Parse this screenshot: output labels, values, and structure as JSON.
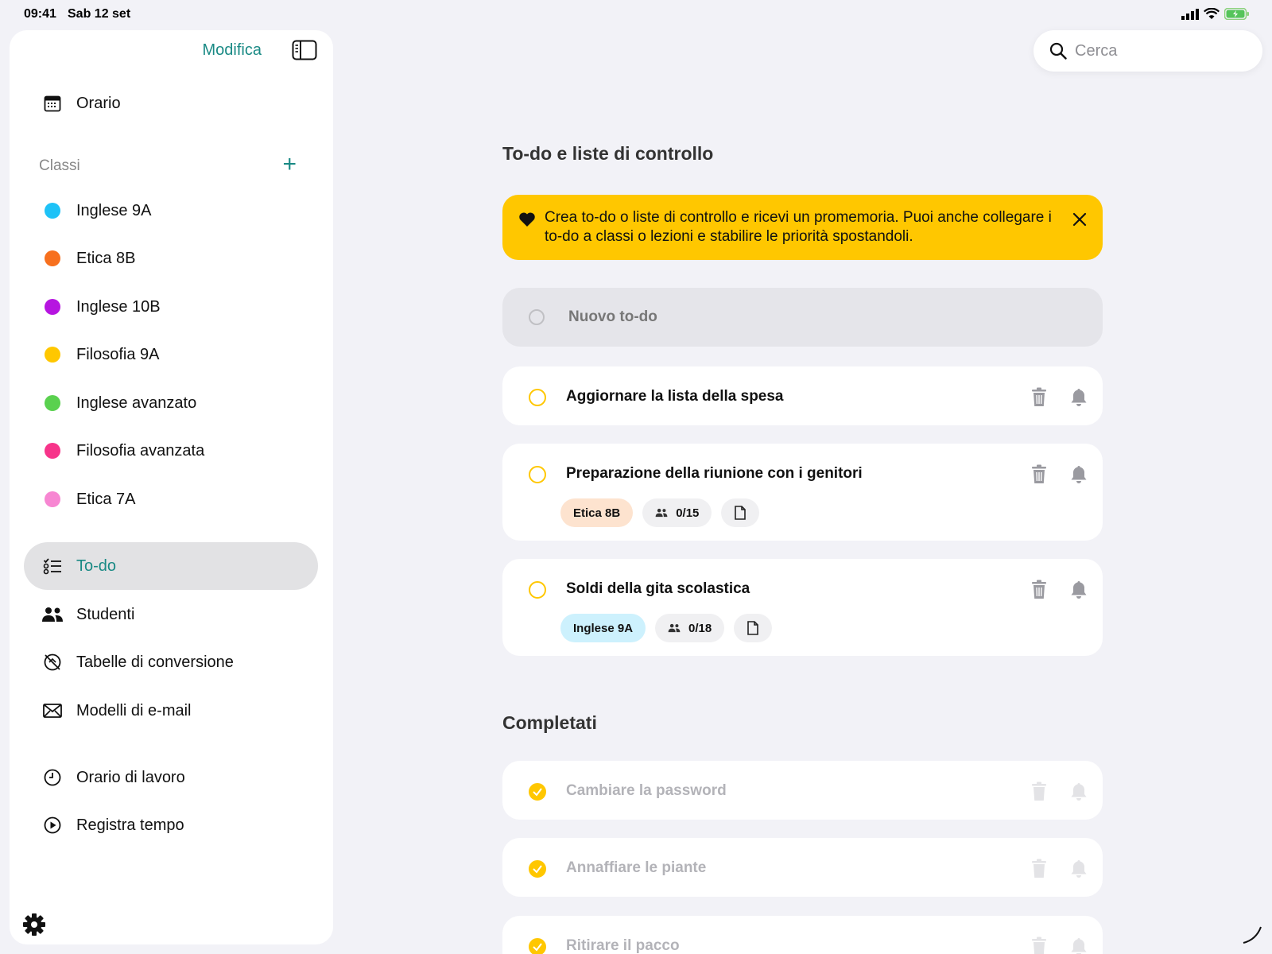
{
  "status": {
    "time": "09:41",
    "date": "Sab 12 set"
  },
  "sidebar": {
    "edit_label": "Modifica",
    "schedule": {
      "label": "Orario",
      "icon": "calendar-icon"
    },
    "classes_title": "Classi",
    "classes": [
      {
        "label": "Inglese 9A",
        "color": "#1ec2f7"
      },
      {
        "label": "Etica 8B",
        "color": "#f7701e"
      },
      {
        "label": "Inglese 10B",
        "color": "#b615e0"
      },
      {
        "label": "Filosofia 9A",
        "color": "#ffc700"
      },
      {
        "label": "Inglese avanzato",
        "color": "#5ad14f"
      },
      {
        "label": "Filosofia avanzata",
        "color": "#f7348a"
      },
      {
        "label": "Etica 7A",
        "color": "#f786d2"
      }
    ],
    "nav": [
      {
        "label": "To-do",
        "icon": "checklist-icon",
        "active": true
      },
      {
        "label": "Studenti",
        "icon": "people-icon"
      },
      {
        "label": "Tabelle di conversione",
        "icon": "conversion-icon"
      },
      {
        "label": "Modelli di e-mail",
        "icon": "envelope-icon"
      }
    ],
    "work": [
      {
        "label": "Orario di lavoro",
        "icon": "clock-icon"
      },
      {
        "label": "Registra tempo",
        "icon": "play-icon"
      }
    ]
  },
  "search": {
    "placeholder": "Cerca"
  },
  "main": {
    "title": "To-do e liste di controllo",
    "banner": "Crea to-do o liste di controllo e ricevi un promemoria. Puoi anche collegare i to-do a classi o lezioni e stabilire le priorità spostandoli.",
    "new_todo_placeholder": "Nuovo to-do",
    "todos": [
      {
        "title": "Aggiornare la lista della spesa"
      },
      {
        "title": "Preparazione della riunione con i genitori",
        "class_tag": "Etica 8B",
        "class_color": "#fde3cf",
        "students": "0/15"
      },
      {
        "title": "Soldi della gita scolastica",
        "class_tag": "Inglese 9A",
        "class_color": "#cdf1fd",
        "students": "0/18"
      }
    ],
    "completed_title": "Completati",
    "completed": [
      {
        "title": "Cambiare la password"
      },
      {
        "title": "Annaffiare le piante"
      },
      {
        "title": "Ritirare il pacco"
      }
    ]
  },
  "colors": {
    "accent": "#1a8a85",
    "highlight": "#ffc700"
  }
}
